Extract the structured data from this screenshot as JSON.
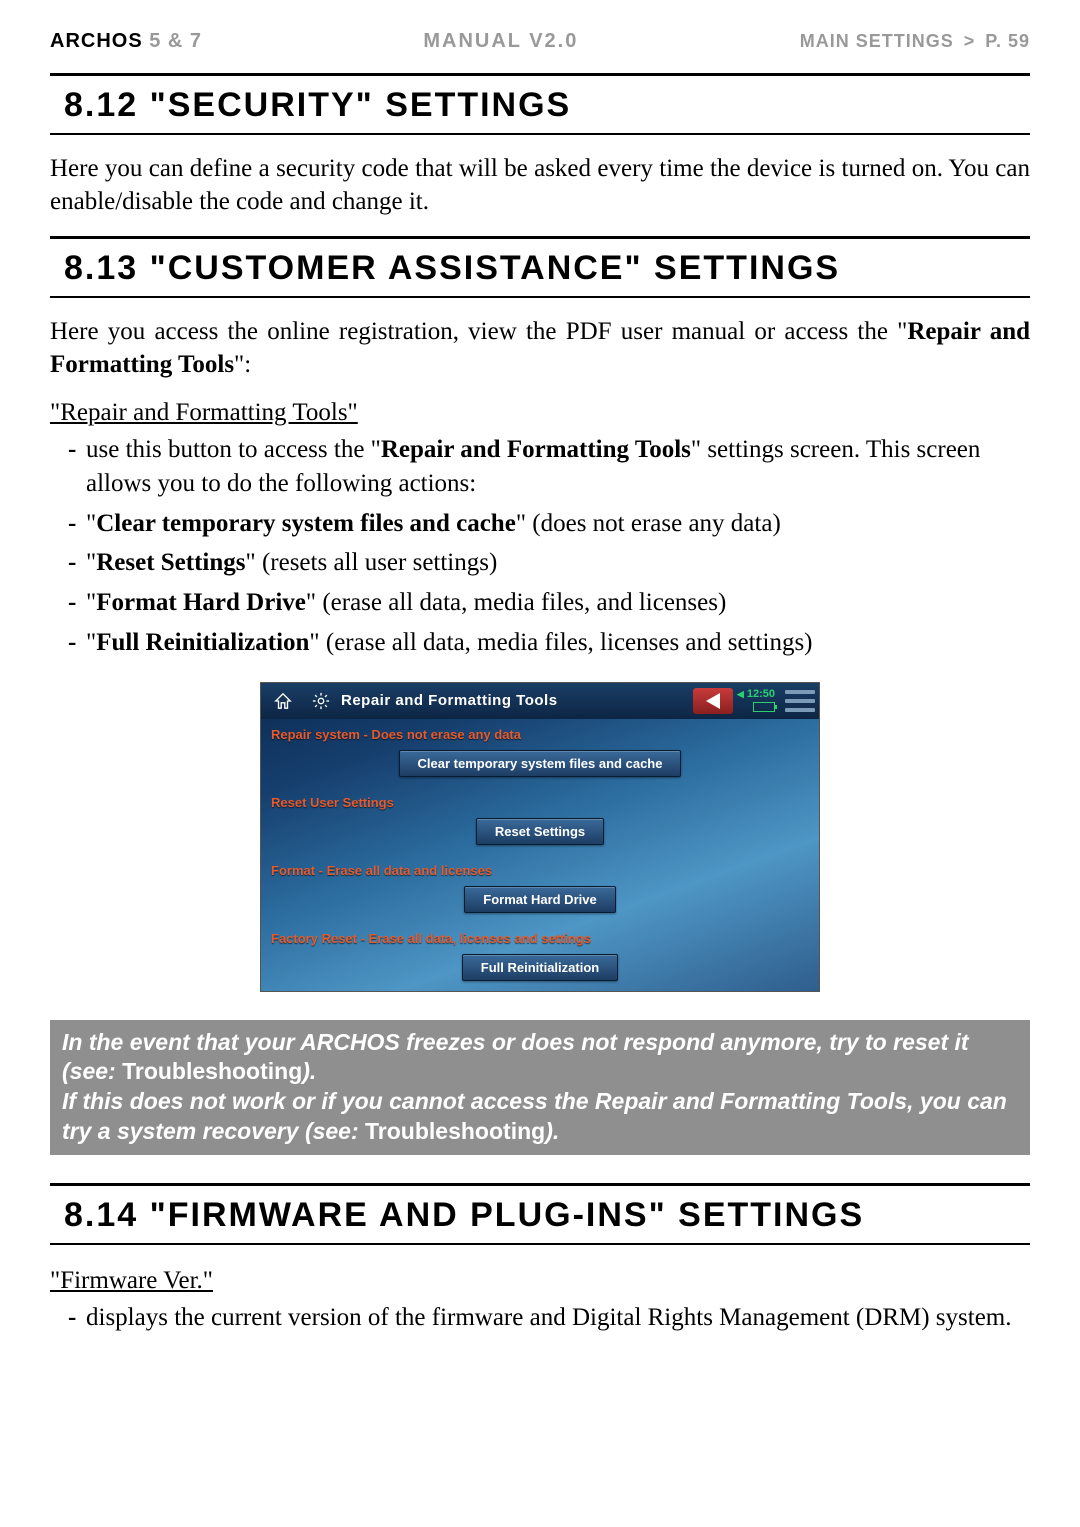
{
  "header": {
    "brand": "ARCHOS",
    "model": "5 & 7",
    "manual": "MANUAL V2.0",
    "breadcrumb_section": "MAIN SETTINGS",
    "breadcrumb_arrow": ">",
    "page_label": "P. 59"
  },
  "section_812": {
    "title": "8.12 \"SECURITY\" SETTINGS",
    "body": "Here you can define a security code that will be asked every time the device is turned on. You can enable/disable the code and change it."
  },
  "section_813": {
    "title": "8.13 \"CUSTOMER ASSISTANCE\" SETTINGS",
    "intro_pre": "Here you access the online registration, view the PDF user manual or access the \"",
    "intro_bold": "Repair and Formatting Tools",
    "intro_post": "\":",
    "subhead": "\"Repair and Formatting Tools\"",
    "bullets": {
      "b1_pre": "use this button to access the \"",
      "b1_bold": "Repair and Formatting Tools",
      "b1_post": "\" settings screen. This screen allows you to do the following actions:",
      "b2_pre": "\"",
      "b2_bold": "Clear temporary system files and cache",
      "b2_post": "\" (does not erase any data)",
      "b3_pre": "\"",
      "b3_bold": "Reset Settings",
      "b3_post": "\" (resets all user settings)",
      "b4_pre": "\"",
      "b4_bold": "Format Hard Drive",
      "b4_post": "\" (erase all data, media files, and licenses)",
      "b5_pre": "\"",
      "b5_bold": "Full Reinitialization",
      "b5_post": "\" (erase all data, media files, licenses and settings)"
    }
  },
  "screenshot": {
    "title": "Repair and Formatting Tools",
    "clock": "12:50",
    "vol_icon_label": "vol",
    "sections": {
      "s1_label": "Repair system - Does not erase any data",
      "s1_button": "Clear temporary system files and cache",
      "s2_label": "Reset User Settings",
      "s2_button": "Reset Settings",
      "s3_label": "Format - Erase all data and licenses",
      "s3_button": "Format Hard Drive",
      "s4_label": "Factory Reset - Erase all data, licenses and settings",
      "s4_button": "Full Reinitialization"
    }
  },
  "callout": {
    "line1_pre": "In the event that your ARCHOS freezes or does not respond anymore, try to reset it (see: ",
    "line1_link": "Troubleshooting",
    "line1_post": ").",
    "line2_pre": "If this does not work or if you cannot access the Repair and Formatting Tools, you can try a system recovery (see: ",
    "line2_link": "Troubleshooting",
    "line2_post": ")."
  },
  "section_814": {
    "title": "8.14 \"FIRMWARE AND PLUG-INS\" SETTINGS",
    "subhead": "\"Firmware Ver.\"",
    "bullet": "displays the current version of the firmware and Digital Rights Management (DRM) system."
  }
}
